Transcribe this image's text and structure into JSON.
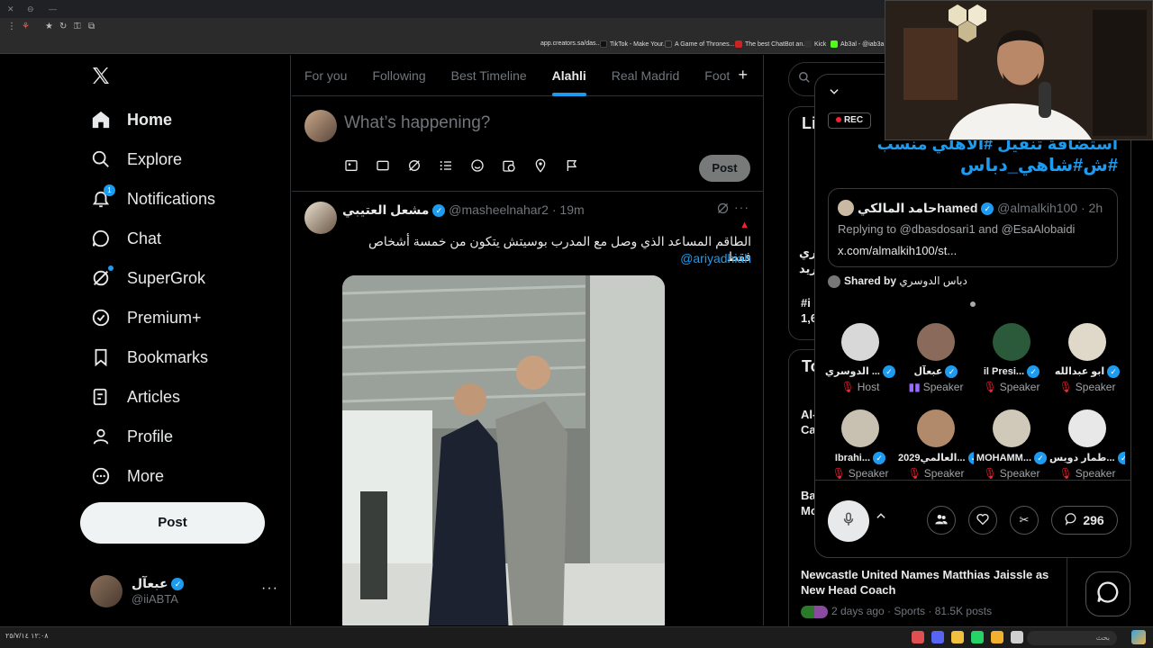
{
  "browser": {
    "bookmarks": [
      {
        "label": "app.creators.sa/das...",
        "color": "#5a5a5a"
      },
      {
        "label": "TikTok - Make Your...",
        "color": "#111111"
      },
      {
        "label": "A Game of Thrones...",
        "color": "#222222"
      },
      {
        "label": "The best ChatBot an...",
        "color": "#cc2222"
      },
      {
        "label": "Kick",
        "color": "#53fc18"
      },
      {
        "label": "Ab3al - @iab3a",
        "color": "#444444"
      }
    ]
  },
  "nav": {
    "items": [
      {
        "label": "Home",
        "icon": "home-icon"
      },
      {
        "label": "Explore",
        "icon": "search-icon"
      },
      {
        "label": "Notifications",
        "icon": "bell-icon",
        "badge": "1"
      },
      {
        "label": "Chat",
        "icon": "chat-icon"
      },
      {
        "label": "SuperGrok",
        "icon": "grok-icon"
      },
      {
        "label": "Premium+",
        "icon": "verified-badge-icon"
      },
      {
        "label": "Bookmarks",
        "icon": "bookmark-icon"
      },
      {
        "label": "Articles",
        "icon": "article-icon"
      },
      {
        "label": "Profile",
        "icon": "person-icon"
      },
      {
        "label": "More",
        "icon": "more-circle-icon"
      }
    ],
    "post_label": "Post",
    "account": {
      "name": "عبعآل",
      "handle": "@iiABTA"
    }
  },
  "timeline": {
    "tabs": [
      "For you",
      "Following",
      "Best Timeline",
      "Alahli",
      "Real Madrid",
      "Foot"
    ],
    "active_tab": "Alahli",
    "composer": {
      "placeholder": "What’s happening?",
      "post_label": "Post"
    },
    "tweet": {
      "name": "مشعل العتيبي",
      "handle": "@masheelnahar2",
      "time": "· 19m",
      "text": "الطاقم المساعد الذي وصل مع المدرب بوسيتش يتكون من خمسة أشخاص فقط",
      "mention": "@ariyadhiah"
    }
  },
  "right": {
    "card1_title": "Li",
    "card2_title": "To",
    "fragments": [
      "ري",
      "ريد",
      "#i",
      "1,6",
      "Al-",
      "Ca",
      "Ba",
      "Mo"
    ],
    "trend": {
      "title": "Newcastle United Names Matthias Jaissle as New Head Coach",
      "meta": "2 days ago · Sports · 81.5K posts"
    }
  },
  "space": {
    "rec_label": "REC",
    "title_line1": "استضافة تنقيل #الاهلي منسب",
    "title_line2": "#ش#شاهي_دباس",
    "quoted": {
      "name": "حامد المالكيhamed",
      "handle": "@almalkih100 · 2h",
      "reply": "Replying to @dbasdosari1 and @EsaAlobaidi",
      "link": "x.com/almalkih100/st..."
    },
    "shared_label": "Shared by",
    "shared_name": "دباس الدوسري",
    "participants": [
      {
        "name": "الدوسري ...",
        "role": "Host",
        "muted": true,
        "color": "#d8d8d8"
      },
      {
        "name": "عبعآل",
        "role": "Speaker",
        "muted": false,
        "color": "#8a6a5a"
      },
      {
        "name": "il Presi...",
        "role": "Speaker",
        "muted": true,
        "color": "#2a5a3a"
      },
      {
        "name": "ابو عبدالله",
        "role": "Speaker",
        "muted": true,
        "color": "#e0d8c8"
      },
      {
        "name": "Ibrahi...",
        "role": "Speaker",
        "muted": true,
        "color": "#c8c0b0"
      },
      {
        "name": "2029العالمي...",
        "role": "Speaker",
        "muted": true,
        "color": "#b08a6a"
      },
      {
        "name": "MOHAMM...",
        "role": "Speaker",
        "muted": true,
        "color": "#d0c8b8"
      },
      {
        "name": "طمار دويس...",
        "role": "Speaker",
        "muted": true,
        "color": "#e8e8e8"
      }
    ],
    "count": "296"
  },
  "taskbar": {
    "search_placeholder": "بحث",
    "clock": "١٢:٠٨ ٢٥/٧/١٤"
  },
  "colors": {
    "accent": "#1d9bf0",
    "mute": "#f4212e"
  }
}
